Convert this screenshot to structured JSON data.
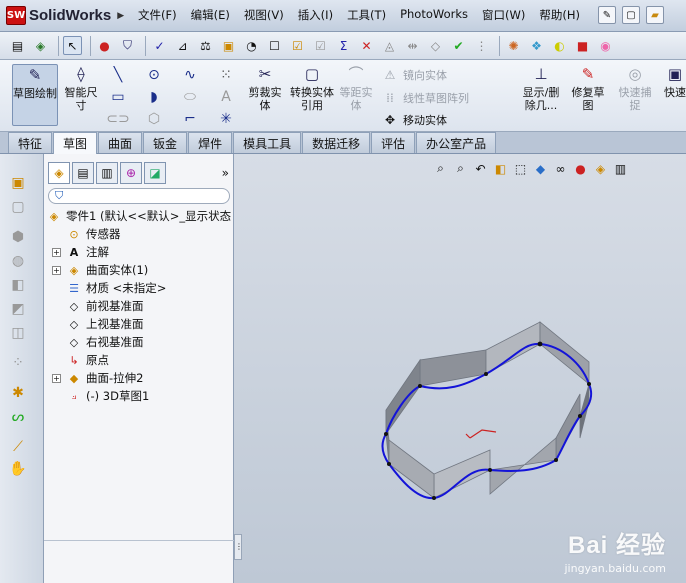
{
  "app": {
    "logo_badge": "SW",
    "logo_text": "SolidWorks"
  },
  "menu": [
    "文件(F)",
    "编辑(E)",
    "视图(V)",
    "插入(I)",
    "工具(T)",
    "PhotoWorks",
    "窗口(W)",
    "帮助(H)"
  ],
  "command_manager": {
    "sketch_button": "草图绘制",
    "smart_dimension": "智能尺寸",
    "trim_entities": "剪裁实体",
    "convert_entities": "转换实体引用",
    "offset_entities": "等距实体",
    "mirror_entities": "镜向实体",
    "linear_pattern": "线性草图阵列",
    "move_entities": "移动实体",
    "display_delete_relations": "显示/删除几...",
    "repair_sketch": "修复草图",
    "quick_snaps": "快速捕捉",
    "rapid_sketch": "快速"
  },
  "tabs": [
    "特征",
    "草图",
    "曲面",
    "钣金",
    "焊件",
    "模具工具",
    "数据迁移",
    "评估",
    "办公室产品"
  ],
  "active_tab": "草图",
  "feature_tree": {
    "expand_glyph": "»",
    "items": [
      {
        "label": "零件1  (默认<<默认>_显示状态",
        "expandable": false
      },
      {
        "label": "传感器",
        "expandable": false
      },
      {
        "label": "注解",
        "expandable": true
      },
      {
        "label": "曲面实体(1)",
        "expandable": true
      },
      {
        "label": "材质 <未指定>",
        "expandable": false
      },
      {
        "label": "前视基准面",
        "expandable": false
      },
      {
        "label": "上视基准面",
        "expandable": false
      },
      {
        "label": "右视基准面",
        "expandable": false
      },
      {
        "label": "原点",
        "expandable": false
      },
      {
        "label": "曲面-拉伸2",
        "expandable": true
      },
      {
        "label": "(-) 3D草图1",
        "expandable": false
      }
    ]
  },
  "watermark": {
    "main": "Bai 经验",
    "url": "jingyan.baidu.com"
  },
  "colors": {
    "surface": "#8b8f96",
    "sketch": "#1414d8",
    "graphics_bg": "#c8d0dc"
  }
}
